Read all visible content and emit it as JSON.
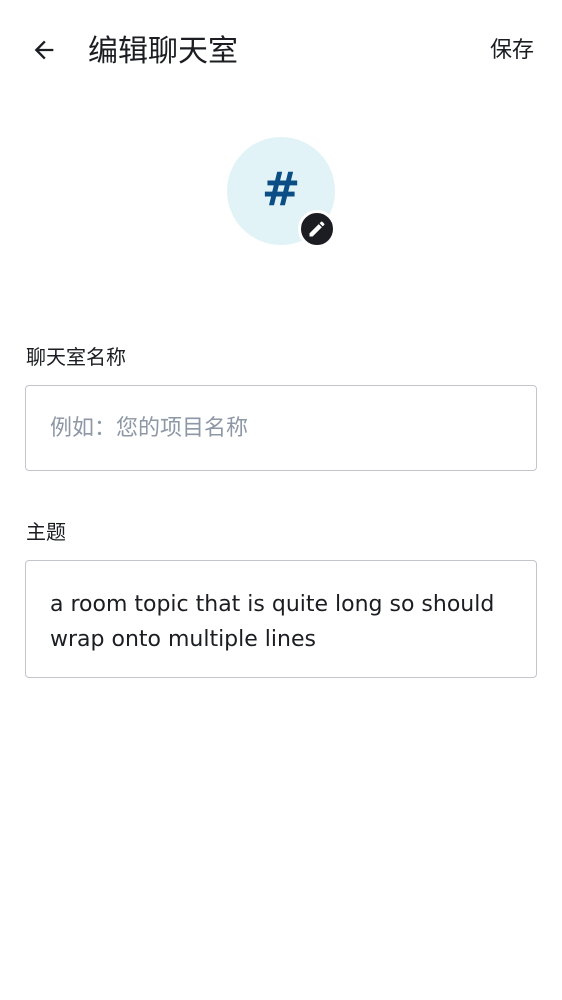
{
  "header": {
    "title": "编辑聊天室",
    "save_label": "保存",
    "back_icon": "arrow-left-icon"
  },
  "avatar": {
    "glyph": "#",
    "background": "#e1f3f7",
    "glyph_color": "#0b4e86",
    "edit_icon": "pencil-icon"
  },
  "room_name": {
    "label": "聊天室名称",
    "value": "",
    "placeholder": "例如：您的项目名称"
  },
  "topic": {
    "label": "主题",
    "value": "a room topic that is quite long so should wrap onto multiple lines"
  },
  "colors": {
    "text": "#1b1d22",
    "placeholder": "#8d97a5",
    "border": "#c2c6cc"
  }
}
